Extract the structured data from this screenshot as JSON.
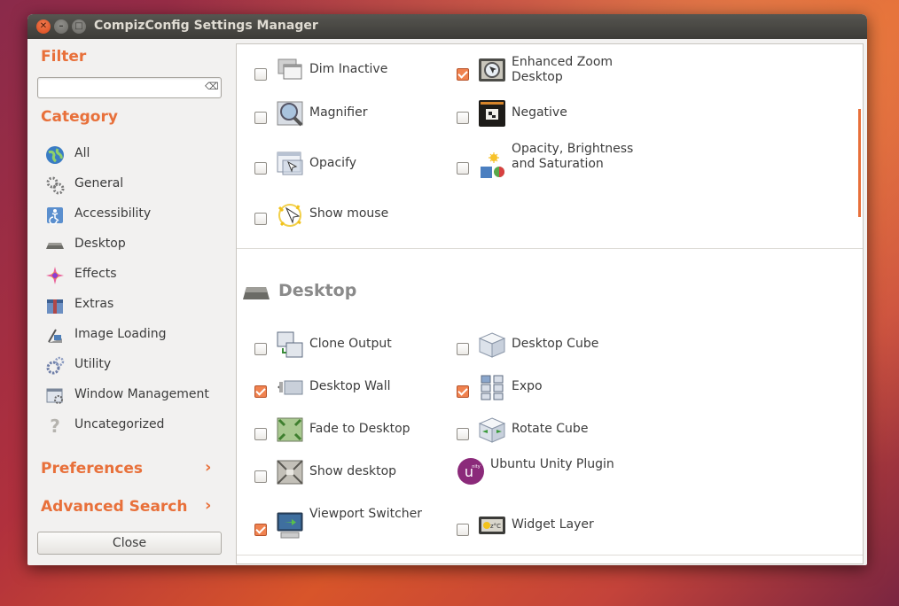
{
  "window": {
    "title": "CompizConfig Settings Manager"
  },
  "sidebar": {
    "filter_label": "Filter",
    "filter_value": "",
    "category_label": "Category",
    "categories": [
      {
        "label": "All",
        "icon": "globe-icon"
      },
      {
        "label": "General",
        "icon": "gears-icon"
      },
      {
        "label": "Accessibility",
        "icon": "accessibility-icon"
      },
      {
        "label": "Desktop",
        "icon": "desktop-icon"
      },
      {
        "label": "Effects",
        "icon": "effects-icon"
      },
      {
        "label": "Extras",
        "icon": "extras-icon"
      },
      {
        "label": "Image Loading",
        "icon": "image-loading-icon"
      },
      {
        "label": "Utility",
        "icon": "utility-icon"
      },
      {
        "label": "Window Management",
        "icon": "window-management-icon"
      },
      {
        "label": "Uncategorized",
        "icon": "question-icon"
      }
    ],
    "preferences_label": "Preferences",
    "advanced_search_label": "Advanced Search",
    "close_label": "Close"
  },
  "accessibility_plugins": [
    {
      "label": "Dim Inactive",
      "checked": false,
      "icon": "dim-inactive-icon"
    },
    {
      "label": "Enhanced Zoom Desktop",
      "checked": true,
      "icon": "enhanced-zoom-icon"
    },
    {
      "label": "Magnifier",
      "checked": false,
      "icon": "magnifier-icon"
    },
    {
      "label": "Negative",
      "checked": false,
      "icon": "negative-icon"
    },
    {
      "label": "Opacify",
      "checked": false,
      "icon": "opacify-icon"
    },
    {
      "label": "Opacity, Brightness and Saturation",
      "checked": false,
      "icon": "obs-icon"
    },
    {
      "label": "Show mouse",
      "checked": false,
      "icon": "show-mouse-icon"
    }
  ],
  "desktop_section": {
    "title": "Desktop",
    "plugins": [
      {
        "label": "Clone Output",
        "checked": false,
        "icon": "clone-output-icon"
      },
      {
        "label": "Desktop Cube",
        "checked": false,
        "icon": "desktop-cube-icon"
      },
      {
        "label": "Desktop Wall",
        "checked": true,
        "icon": "desktop-wall-icon"
      },
      {
        "label": "Expo",
        "checked": true,
        "icon": "expo-icon"
      },
      {
        "label": "Fade to Desktop",
        "checked": false,
        "icon": "fade-to-desktop-icon"
      },
      {
        "label": "Rotate Cube",
        "checked": false,
        "icon": "rotate-cube-icon"
      },
      {
        "label": "Show desktop",
        "checked": false,
        "icon": "show-desktop-icon"
      },
      {
        "label": "Ubuntu Unity Plugin",
        "checked": null,
        "icon": "ubuntu-unity-icon"
      },
      {
        "label": "Viewport Switcher",
        "checked": true,
        "icon": "viewport-switcher-icon"
      },
      {
        "label": "Widget Layer",
        "checked": false,
        "icon": "widget-layer-icon"
      }
    ]
  },
  "colors": {
    "accent": "#e8703a",
    "checkbox_on": "#f0824f",
    "titlebar": "#3d3c38",
    "panel_bg": "#f2f1f0"
  }
}
